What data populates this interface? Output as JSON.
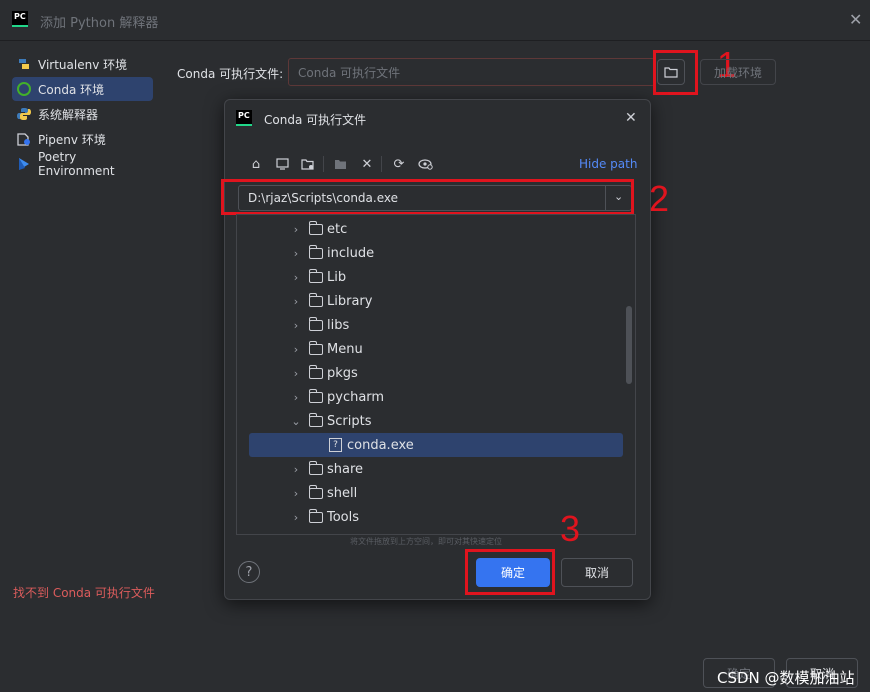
{
  "window": {
    "title": "添加 Python 解释器",
    "logo": "PC"
  },
  "sidebar": {
    "items": [
      {
        "label": "Virtualenv 环境",
        "icon": "virtualenv-icon"
      },
      {
        "label": "Conda 环境",
        "icon": "conda-icon",
        "selected": true
      },
      {
        "label": "系统解释器",
        "icon": "python-icon"
      },
      {
        "label": "Pipenv 环境",
        "icon": "pipenv-icon"
      },
      {
        "label": "Poetry Environment",
        "icon": "poetry-icon"
      }
    ],
    "error": "找不到 Conda 可执行文件"
  },
  "main": {
    "conda_label": "Conda 可执行文件:",
    "conda_placeholder": "Conda 可执行文件",
    "load_env": "加载环境"
  },
  "annotations": {
    "n1": "1",
    "n2": "2",
    "n3": "3"
  },
  "dialog": {
    "title": "Conda 可执行文件",
    "hide_path": "Hide path",
    "path": "D:\\rjaz\\Scripts\\conda.exe",
    "tree": [
      {
        "name": "etc",
        "expanded": false
      },
      {
        "name": "include",
        "expanded": false
      },
      {
        "name": "Lib",
        "expanded": false
      },
      {
        "name": "Library",
        "expanded": false
      },
      {
        "name": "libs",
        "expanded": false
      },
      {
        "name": "Menu",
        "expanded": false
      },
      {
        "name": "pkgs",
        "expanded": false
      },
      {
        "name": "pycharm",
        "expanded": false
      },
      {
        "name": "Scripts",
        "expanded": true
      },
      {
        "name": "conda.exe",
        "file": true,
        "selected": true
      },
      {
        "name": "share",
        "expanded": false
      },
      {
        "name": "shell",
        "expanded": false
      },
      {
        "name": "Tools",
        "expanded": false
      }
    ],
    "hint": "将文件拖放到上方空间，即可对其快速定位",
    "help": "?",
    "ok": "确定",
    "cancel": "取消"
  },
  "footer": {
    "ok": "确定",
    "cancel": "取消"
  },
  "watermark": "CSDN @数模加油站",
  "colors": {
    "accent": "#3574f0",
    "annotation": "#e0141e",
    "selection": "#2e436e",
    "error": "#db5c5c"
  }
}
